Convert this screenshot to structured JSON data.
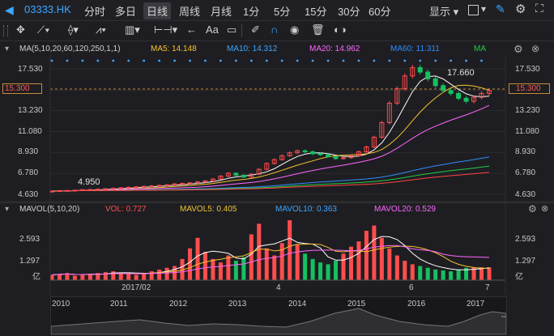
{
  "topbar": {
    "symbol": "03333.HK",
    "periods": [
      "分时",
      "多日",
      "日线",
      "周线",
      "月线",
      "1分",
      "5分",
      "15分",
      "30分",
      "60分"
    ],
    "active_period": "日线",
    "display_label": "显示"
  },
  "toolbar": {
    "text_tool": "Aa"
  },
  "ma_legend": {
    "title": "MA(5,10,20,60,120,250,1,1)",
    "ma5": "MA5: 14.148",
    "ma10": "MA10: 14.312",
    "ma20": "MA20: 14.962",
    "ma60": "MA60: 11.311",
    "ma_short": "MA"
  },
  "price_axis": {
    "ticks": [
      "17.530",
      "15.300",
      "13.230",
      "11.080",
      "8.930",
      "6.780",
      "4.630"
    ],
    "current_price": "15.300",
    "high_label": "17.660",
    "low_label": "4.950"
  },
  "vol_legend": {
    "title": "MAVOL(5,10,20)",
    "vol": "VOL: 0.727",
    "mavol5": "MAVOL5: 0.405",
    "mavol10": "MAVOL10: 0.363",
    "mavol20": "MAVOL20: 0.529"
  },
  "vol_axis": {
    "ticks": [
      "2.593",
      "1.297",
      "亿"
    ]
  },
  "time_axis": {
    "labels": [
      "2017/02",
      "4",
      "6",
      "7"
    ]
  },
  "navigator": {
    "years": [
      "2010",
      "2011",
      "2012",
      "2013",
      "2014",
      "2015",
      "2016",
      "2017"
    ]
  },
  "colors": {
    "up": "#ff4d4d",
    "down": "#16c060",
    "ma5": "#ffffff",
    "ma10": "#f2c230",
    "ma20": "#ff66ff",
    "ma60": "#2f8dff",
    "ma120": "#22cc44",
    "ma250": "#ff4444",
    "accent": "#3ea6ff"
  },
  "chart_data": {
    "type": "candlestick",
    "price_series_close": [
      4.95,
      5.0,
      5.02,
      5.05,
      5.1,
      5.12,
      5.15,
      5.2,
      5.25,
      5.3,
      5.35,
      5.4,
      5.45,
      5.5,
      5.55,
      5.6,
      5.7,
      5.75,
      5.8,
      5.9,
      6.0,
      6.2,
      6.5,
      6.8,
      6.6,
      6.4,
      6.7,
      7.2,
      7.8,
      8.2,
      8.6,
      8.9,
      9.1,
      9.0,
      8.8,
      8.7,
      8.5,
      8.3,
      8.4,
      8.6,
      9.0,
      9.5,
      10.5,
      12.0,
      14.0,
      15.5,
      16.8,
      17.66,
      17.2,
      16.5,
      15.8,
      15.3,
      15.0,
      14.5,
      14.2,
      14.6,
      15.0,
      15.3
    ],
    "volume_yi": [
      0.3,
      0.35,
      0.4,
      0.25,
      0.3,
      0.35,
      0.4,
      0.45,
      0.5,
      0.4,
      0.35,
      0.3,
      0.4,
      0.5,
      0.6,
      0.7,
      0.8,
      1.2,
      1.8,
      2.4,
      1.6,
      1.2,
      1.0,
      1.4,
      1.1,
      1.3,
      2.6,
      3.2,
      1.8,
      1.4,
      2.1,
      3.4,
      2.0,
      1.5,
      1.2,
      1.0,
      0.9,
      1.1,
      1.5,
      1.9,
      2.2,
      2.8,
      3.1,
      2.4,
      1.8,
      1.4,
      1.1,
      0.9,
      0.8,
      0.7,
      0.6,
      0.55,
      0.5,
      0.6,
      0.7,
      0.72,
      0.73,
      0.727
    ],
    "ma_values": {
      "MA5": 14.148,
      "MA10": 14.312,
      "MA20": 14.962,
      "MA60": 11.311
    },
    "ylim": [
      4.63,
      17.53
    ],
    "yticks": [
      17.53,
      15.3,
      13.23,
      11.08,
      8.93,
      6.78,
      4.63
    ]
  }
}
